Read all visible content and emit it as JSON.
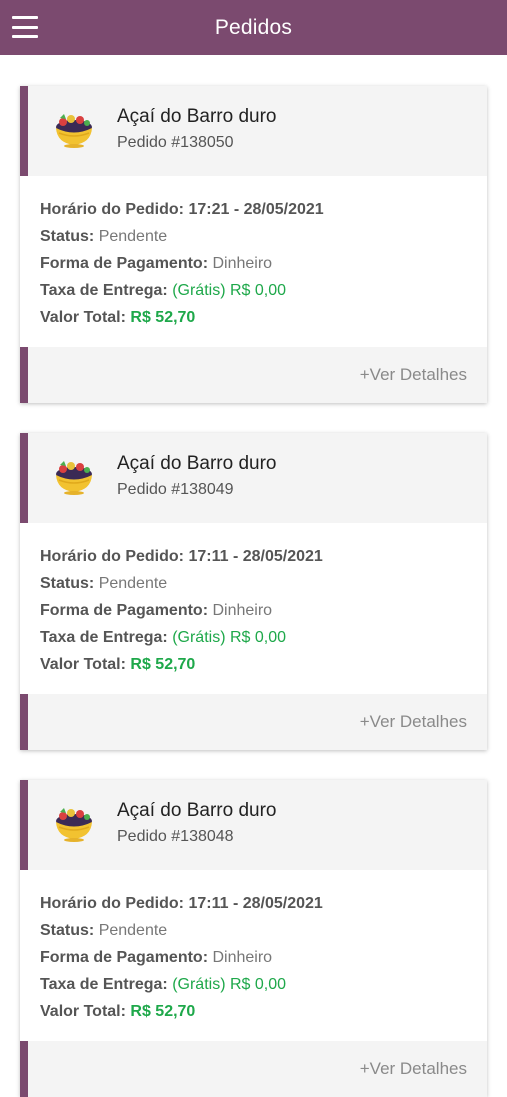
{
  "header": {
    "title": "Pedidos",
    "menu_icon": "hamburger-menu-icon",
    "color": "#7b4a6f"
  },
  "labels": {
    "time": "Horário do Pedido:",
    "status": "Status:",
    "payment": "Forma de Pagamento:",
    "delivery": "Taxa de Entrega:",
    "total": "Valor Total:",
    "details": "+Ver Detalhes"
  },
  "orders": [
    {
      "store": "Açaí do Barro duro",
      "order_number": "Pedido #138050",
      "time": "17:21 - 28/05/2021",
      "status": "Pendente",
      "payment": "Dinheiro",
      "delivery_free": "(Grátis)",
      "delivery_fee": "R$ 0,00",
      "total": "R$ 52,70"
    },
    {
      "store": "Açaí do Barro duro",
      "order_number": "Pedido #138049",
      "time": "17:11 - 28/05/2021",
      "status": "Pendente",
      "payment": "Dinheiro",
      "delivery_free": "(Grátis)",
      "delivery_fee": "R$ 0,00",
      "total": "R$ 52,70"
    },
    {
      "store": "Açaí do Barro duro",
      "order_number": "Pedido #138048",
      "time": "17:11 - 28/05/2021",
      "status": "Pendente",
      "payment": "Dinheiro",
      "delivery_free": "(Grátis)",
      "delivery_fee": "R$ 0,00",
      "total": "R$ 52,70"
    }
  ],
  "colors": {
    "accent": "#7b4a6f",
    "green": "#1ea84a",
    "card_head": "#f4f4f4"
  }
}
